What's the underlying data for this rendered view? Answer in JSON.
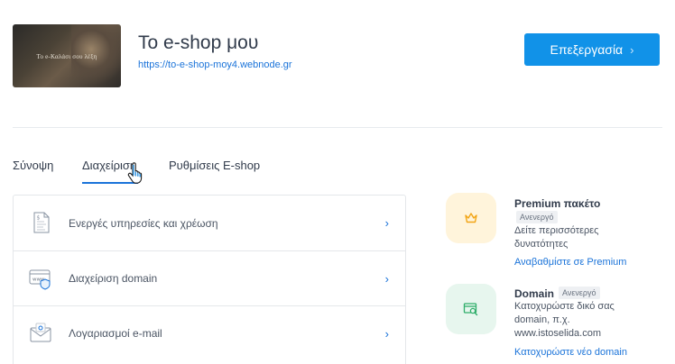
{
  "site": {
    "thumbnail_caption": "Το e-Καλάσι σου λέξη",
    "title": "Το e-shop μου",
    "url": "https://to-e-shop-moy4.webnode.gr",
    "edit_label": "Επεξεργασία",
    "edit_chevron": "›"
  },
  "tabs": [
    {
      "label": "Σύνοψη"
    },
    {
      "label": "Διαχείριση"
    },
    {
      "label": "Ρυθμίσεις E-shop"
    }
  ],
  "menu": {
    "items": [
      {
        "label": "Ενεργές υπηρεσίες και χρέωση",
        "icon": "invoice-icon"
      },
      {
        "label": "Διαχείριση domain",
        "icon": "www-shield-icon"
      },
      {
        "label": "Λογαριασμοί e-mail",
        "icon": "envelope-icon"
      }
    ],
    "chevron": "›"
  },
  "features": {
    "premium": {
      "title": "Premium πακέτο",
      "badge": "Ανενεργό",
      "desc_line1": "Δείτε περισσότερες",
      "desc_line2": "δυνατότητες",
      "link": "Αναβαθμίστε σε Premium",
      "icon": "crown-icon"
    },
    "domain": {
      "title": "Domain",
      "badge": "Ανενεργό",
      "desc_line1": "Κατοχυρώστε δικό σας",
      "desc_line2": "domain, π.χ.",
      "desc_line3": "www.istoselida.com",
      "link": "Κατοχυρώστε νέο domain",
      "icon": "domain-search-icon"
    }
  },
  "colors": {
    "accent": "#1192e8",
    "link": "#1a73d9",
    "premium_bg": "#fff4db",
    "premium_icon": "#f2a516",
    "domain_bg": "#e7f6ee",
    "domain_icon": "#2fae6a"
  }
}
